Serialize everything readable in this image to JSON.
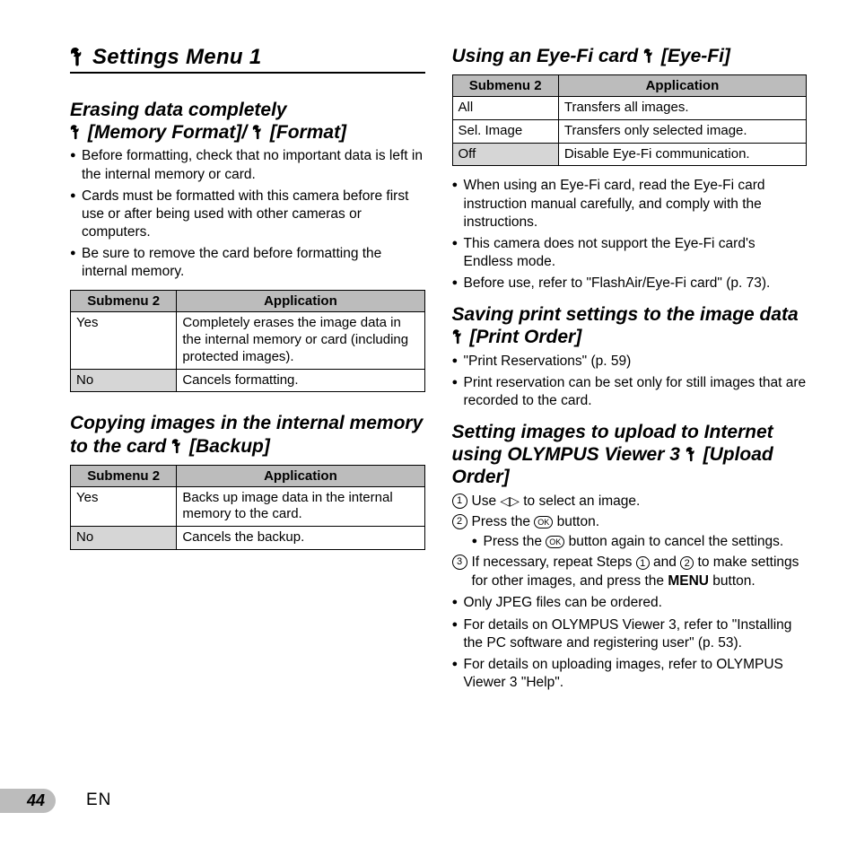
{
  "page": {
    "number": "44",
    "lang": "EN"
  },
  "chapter": {
    "title": "Settings Menu 1"
  },
  "sec_format": {
    "title_line1": "Erasing data completely",
    "title_line2": "[Memory Format]/",
    "title_line3": "[Format]",
    "b1": "Before formatting, check that no important data is left in the internal memory or card.",
    "b2": "Cards must be formatted with this camera before first use or after being used with other cameras or computers.",
    "b3": "Be sure to remove the card before formatting the internal memory.",
    "th1": "Submenu 2",
    "th2": "Application",
    "r1c1": "Yes",
    "r1c2": "Completely erases the image data in the internal memory or card (including protected images).",
    "r2c1": "No",
    "r2c2": "Cancels formatting."
  },
  "sec_backup": {
    "title_line1": "Copying images in the internal memory to the card ",
    "title_line2": "[Backup]",
    "th1": "Submenu 2",
    "th2": "Application",
    "r1c1": "Yes",
    "r1c2": "Backs up image data in the internal memory to the card.",
    "r2c1": "No",
    "r2c2": "Cancels the backup."
  },
  "sec_eyefi": {
    "title": "Using an Eye-Fi card ",
    "title2": "[Eye-Fi]",
    "th1": "Submenu 2",
    "th2": "Application",
    "r1c1": "All",
    "r1c2": "Transfers all images.",
    "r2c1": "Sel. Image",
    "r2c2": "Transfers only selected image.",
    "r3c1": "Off",
    "r3c2": "Disable Eye-Fi communication.",
    "b1": "When using an Eye-Fi card, read the Eye-Fi card instruction manual carefully, and comply with the instructions.",
    "b2": "This camera does not support the Eye-Fi card's Endless mode.",
    "b3": "Before use, refer to \"FlashAir/Eye-Fi card\" (p. 73)."
  },
  "sec_print": {
    "title_line1": "Saving print settings to the image data ",
    "title_line2": "[Print Order]",
    "b1": "\"Print Reservations\" (p. 59)",
    "b2": "Print reservation can be set only for still images that are recorded to the card."
  },
  "sec_upload": {
    "title_line1": "Setting images to upload to Internet using OLYMPUS Viewer 3 ",
    "title_line2": "[Upload Order]",
    "s1a": "Use ",
    "s1b": " to select an image.",
    "s2a": "Press the ",
    "s2b": " button.",
    "s2sub_a": "Press the ",
    "s2sub_b": " button again to cancel the settings.",
    "s3a": "If necessary, repeat Steps ",
    "s3b": " and ",
    "s3c": " to make settings for other images, and press the ",
    "s3d": "MENU",
    "s3e": " button.",
    "b1": "Only JPEG files can be ordered.",
    "b2": "For details on OLYMPUS Viewer 3, refer to \"Installing the PC software and registering user\" (p. 53).",
    "b3": "For details on uploading images, refer to OLYMPUS Viewer 3 \"Help\"."
  },
  "icons": {
    "ok": "OK",
    "n1": "1",
    "n2": "2"
  }
}
